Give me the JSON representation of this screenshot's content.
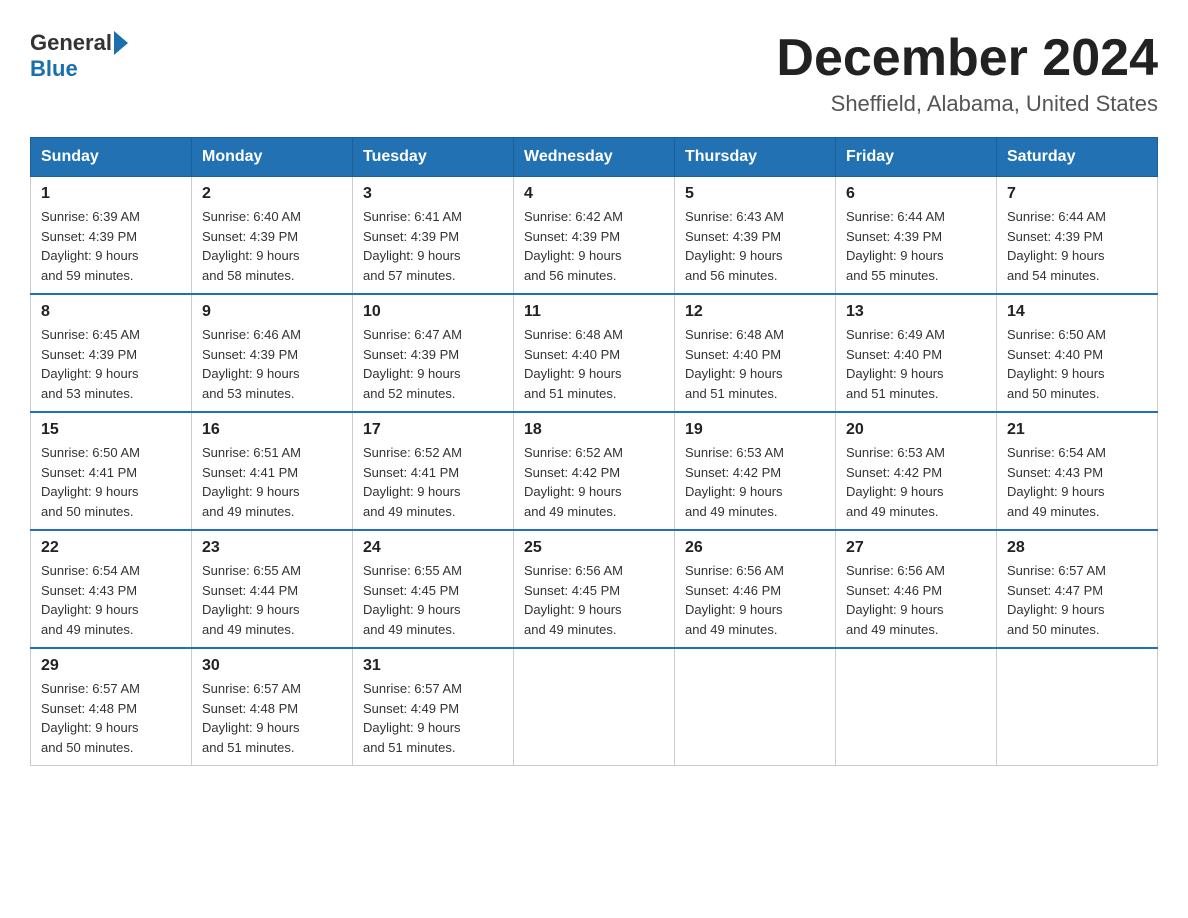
{
  "logo": {
    "general": "General",
    "blue": "Blue"
  },
  "header": {
    "title": "December 2024",
    "subtitle": "Sheffield, Alabama, United States"
  },
  "days_of_week": [
    "Sunday",
    "Monday",
    "Tuesday",
    "Wednesday",
    "Thursday",
    "Friday",
    "Saturday"
  ],
  "weeks": [
    [
      {
        "day": "1",
        "sunrise": "6:39 AM",
        "sunset": "4:39 PM",
        "daylight": "9 hours and 59 minutes."
      },
      {
        "day": "2",
        "sunrise": "6:40 AM",
        "sunset": "4:39 PM",
        "daylight": "9 hours and 58 minutes."
      },
      {
        "day": "3",
        "sunrise": "6:41 AM",
        "sunset": "4:39 PM",
        "daylight": "9 hours and 57 minutes."
      },
      {
        "day": "4",
        "sunrise": "6:42 AM",
        "sunset": "4:39 PM",
        "daylight": "9 hours and 56 minutes."
      },
      {
        "day": "5",
        "sunrise": "6:43 AM",
        "sunset": "4:39 PM",
        "daylight": "9 hours and 56 minutes."
      },
      {
        "day": "6",
        "sunrise": "6:44 AM",
        "sunset": "4:39 PM",
        "daylight": "9 hours and 55 minutes."
      },
      {
        "day": "7",
        "sunrise": "6:44 AM",
        "sunset": "4:39 PM",
        "daylight": "9 hours and 54 minutes."
      }
    ],
    [
      {
        "day": "8",
        "sunrise": "6:45 AM",
        "sunset": "4:39 PM",
        "daylight": "9 hours and 53 minutes."
      },
      {
        "day": "9",
        "sunrise": "6:46 AM",
        "sunset": "4:39 PM",
        "daylight": "9 hours and 53 minutes."
      },
      {
        "day": "10",
        "sunrise": "6:47 AM",
        "sunset": "4:39 PM",
        "daylight": "9 hours and 52 minutes."
      },
      {
        "day": "11",
        "sunrise": "6:48 AM",
        "sunset": "4:40 PM",
        "daylight": "9 hours and 51 minutes."
      },
      {
        "day": "12",
        "sunrise": "6:48 AM",
        "sunset": "4:40 PM",
        "daylight": "9 hours and 51 minutes."
      },
      {
        "day": "13",
        "sunrise": "6:49 AM",
        "sunset": "4:40 PM",
        "daylight": "9 hours and 51 minutes."
      },
      {
        "day": "14",
        "sunrise": "6:50 AM",
        "sunset": "4:40 PM",
        "daylight": "9 hours and 50 minutes."
      }
    ],
    [
      {
        "day": "15",
        "sunrise": "6:50 AM",
        "sunset": "4:41 PM",
        "daylight": "9 hours and 50 minutes."
      },
      {
        "day": "16",
        "sunrise": "6:51 AM",
        "sunset": "4:41 PM",
        "daylight": "9 hours and 49 minutes."
      },
      {
        "day": "17",
        "sunrise": "6:52 AM",
        "sunset": "4:41 PM",
        "daylight": "9 hours and 49 minutes."
      },
      {
        "day": "18",
        "sunrise": "6:52 AM",
        "sunset": "4:42 PM",
        "daylight": "9 hours and 49 minutes."
      },
      {
        "day": "19",
        "sunrise": "6:53 AM",
        "sunset": "4:42 PM",
        "daylight": "9 hours and 49 minutes."
      },
      {
        "day": "20",
        "sunrise": "6:53 AM",
        "sunset": "4:42 PM",
        "daylight": "9 hours and 49 minutes."
      },
      {
        "day": "21",
        "sunrise": "6:54 AM",
        "sunset": "4:43 PM",
        "daylight": "9 hours and 49 minutes."
      }
    ],
    [
      {
        "day": "22",
        "sunrise": "6:54 AM",
        "sunset": "4:43 PM",
        "daylight": "9 hours and 49 minutes."
      },
      {
        "day": "23",
        "sunrise": "6:55 AM",
        "sunset": "4:44 PM",
        "daylight": "9 hours and 49 minutes."
      },
      {
        "day": "24",
        "sunrise": "6:55 AM",
        "sunset": "4:45 PM",
        "daylight": "9 hours and 49 minutes."
      },
      {
        "day": "25",
        "sunrise": "6:56 AM",
        "sunset": "4:45 PM",
        "daylight": "9 hours and 49 minutes."
      },
      {
        "day": "26",
        "sunrise": "6:56 AM",
        "sunset": "4:46 PM",
        "daylight": "9 hours and 49 minutes."
      },
      {
        "day": "27",
        "sunrise": "6:56 AM",
        "sunset": "4:46 PM",
        "daylight": "9 hours and 49 minutes."
      },
      {
        "day": "28",
        "sunrise": "6:57 AM",
        "sunset": "4:47 PM",
        "daylight": "9 hours and 50 minutes."
      }
    ],
    [
      {
        "day": "29",
        "sunrise": "6:57 AM",
        "sunset": "4:48 PM",
        "daylight": "9 hours and 50 minutes."
      },
      {
        "day": "30",
        "sunrise": "6:57 AM",
        "sunset": "4:48 PM",
        "daylight": "9 hours and 51 minutes."
      },
      {
        "day": "31",
        "sunrise": "6:57 AM",
        "sunset": "4:49 PM",
        "daylight": "9 hours and 51 minutes."
      },
      null,
      null,
      null,
      null
    ]
  ],
  "labels": {
    "sunrise": "Sunrise:",
    "sunset": "Sunset:",
    "daylight": "Daylight:"
  }
}
